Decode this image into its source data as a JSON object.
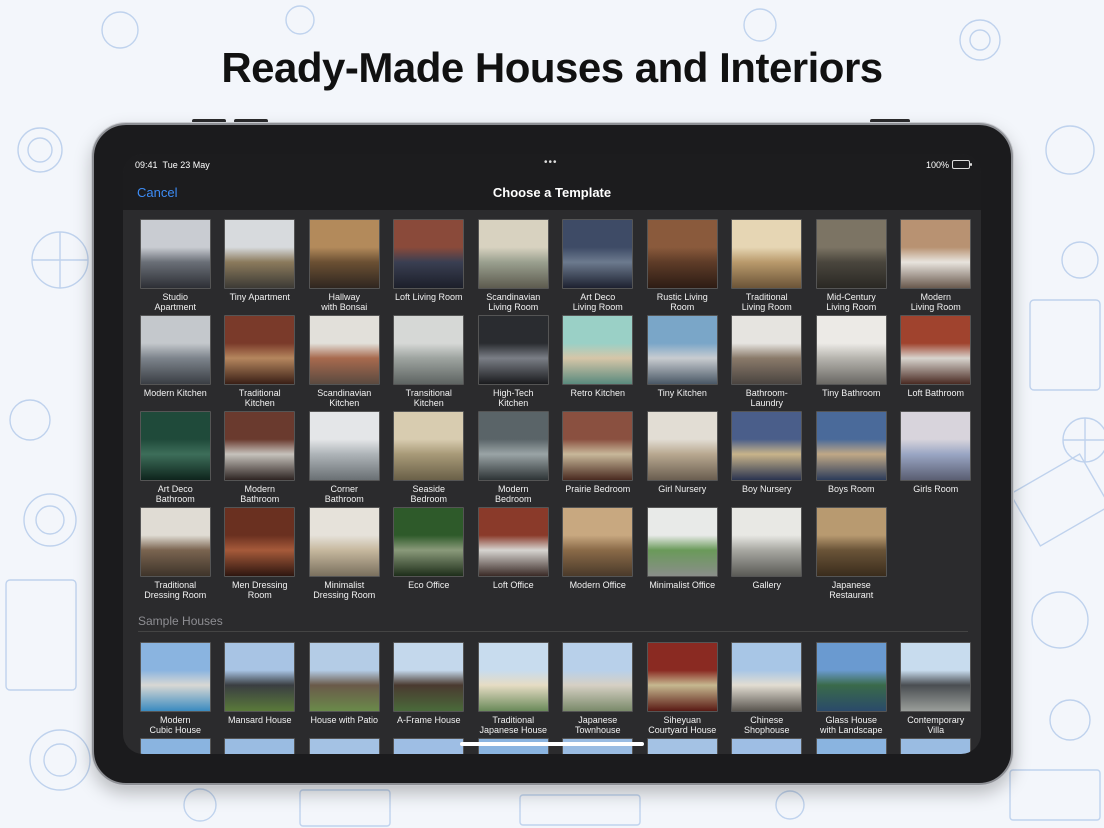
{
  "headline": "Ready-Made Houses and Interiors",
  "status": {
    "time": "09:41",
    "date": "Tue 23 May",
    "dots": "•••",
    "battery": "100%"
  },
  "nav": {
    "cancel": "Cancel",
    "title": "Choose a Template"
  },
  "templates": [
    {
      "label": "Studio\nApartment",
      "colors": [
        "#c9ccd2",
        "#6a6f77",
        "#2d2f35"
      ]
    },
    {
      "label": "Tiny Apartment",
      "colors": [
        "#d7dadd",
        "#8b7a5c",
        "#3c3a35"
      ]
    },
    {
      "label": "Hallway\nwith Bonsai",
      "colors": [
        "#b38a5b",
        "#6b5033",
        "#2f2620"
      ]
    },
    {
      "label": "Loft Living Room",
      "colors": [
        "#8a4a3a",
        "#3a3f52",
        "#1c1f2a"
      ]
    },
    {
      "label": "Scandinavian\nLiving Room",
      "colors": [
        "#d8d2c0",
        "#9aa08f",
        "#5d5b4f"
      ]
    },
    {
      "label": "Art Deco\nLiving Room",
      "colors": [
        "#3e4b66",
        "#6c7a8e",
        "#1d2130"
      ]
    },
    {
      "label": "Rustic Living\nRoom",
      "colors": [
        "#8a5a3c",
        "#5e3c28",
        "#2d1c14"
      ]
    },
    {
      "label": "Traditional\nLiving Room",
      "colors": [
        "#e6d6b4",
        "#b99a6c",
        "#6b5438"
      ]
    },
    {
      "label": "Mid-Century\nLiving Room",
      "colors": [
        "#7c7464",
        "#4a463d",
        "#2a2824"
      ]
    },
    {
      "label": "Modern\nLiving Room",
      "colors": [
        "#b89272",
        "#e8e4de",
        "#6a5a4e"
      ]
    },
    {
      "label": "Modern Kitchen",
      "colors": [
        "#c4c8cc",
        "#7d848c",
        "#3a3e44"
      ]
    },
    {
      "label": "Traditional\nKitchen",
      "colors": [
        "#7a3a2a",
        "#b5865e",
        "#3a1f16"
      ]
    },
    {
      "label": "Scandinavian\nKitchen",
      "colors": [
        "#e2e0da",
        "#a86a4e",
        "#5a4a40"
      ]
    },
    {
      "label": "Transitional\nKitchen",
      "colors": [
        "#d6d8d6",
        "#9ea4a0",
        "#5e6462"
      ]
    },
    {
      "label": "High-Tech\nKitchen",
      "colors": [
        "#2a2c30",
        "#7a7e86",
        "#1a1b1e"
      ]
    },
    {
      "label": "Retro Kitchen",
      "colors": [
        "#9ad0c6",
        "#d6c6a8",
        "#5a8a7e"
      ]
    },
    {
      "label": "Tiny Kitchen",
      "colors": [
        "#7aa6c8",
        "#c8ccd0",
        "#4a5866"
      ]
    },
    {
      "label": "Bathroom-\nLaundry",
      "colors": [
        "#e6e4e0",
        "#8a7a6a",
        "#4a4440"
      ]
    },
    {
      "label": "Tiny Bathroom",
      "colors": [
        "#eceae6",
        "#b6b4ae",
        "#6a6864"
      ]
    },
    {
      "label": "Loft Bathroom",
      "colors": [
        "#a0432e",
        "#d8d4ce",
        "#4a2a22"
      ]
    },
    {
      "label": "Art Deco\nBathroom",
      "colors": [
        "#1f4a3a",
        "#3d6e5a",
        "#0e241c"
      ]
    },
    {
      "label": "Modern\nBathroom",
      "colors": [
        "#6a3a2e",
        "#c6c2bc",
        "#2e2422"
      ]
    },
    {
      "label": "Corner\nBathroom",
      "colors": [
        "#e4e6e8",
        "#aeb4b8",
        "#6a7074"
      ]
    },
    {
      "label": "Seaside\nBedroom",
      "colors": [
        "#d8ccb0",
        "#a89a78",
        "#6a6048"
      ]
    },
    {
      "label": "Modern\nBedroom",
      "colors": [
        "#5a6468",
        "#9aa4a6",
        "#2e3436"
      ]
    },
    {
      "label": "Prairie Bedroom",
      "colors": [
        "#8a5040",
        "#c8b89a",
        "#4a2a20"
      ]
    },
    {
      "label": "Girl Nursery",
      "colors": [
        "#e2ddd4",
        "#b8a890",
        "#6a5e50"
      ]
    },
    {
      "label": "Boy Nursery",
      "colors": [
        "#4a5e8a",
        "#c8b48a",
        "#2a3450"
      ]
    },
    {
      "label": "Boys Room",
      "colors": [
        "#4a6a9a",
        "#c0a886",
        "#2c3c5a"
      ]
    },
    {
      "label": "Girls Room",
      "colors": [
        "#d8d4dc",
        "#9aa6c4",
        "#5a5e72"
      ]
    },
    {
      "label": "Traditional\nDressing Room",
      "colors": [
        "#e0dcd4",
        "#7a6450",
        "#3e342a"
      ]
    },
    {
      "label": "Men Dressing\nRoom",
      "colors": [
        "#6a3020",
        "#a65a3a",
        "#2e1610"
      ]
    },
    {
      "label": "Minimalist\nDressing Room",
      "colors": [
        "#e6e2da",
        "#c6b89e",
        "#7a705e"
      ]
    },
    {
      "label": "Eco Office",
      "colors": [
        "#2e5a2a",
        "#8a9a7a",
        "#1e2e1a"
      ]
    },
    {
      "label": "Loft Office",
      "colors": [
        "#8a3a2a",
        "#d6d4d0",
        "#3a2a26"
      ]
    },
    {
      "label": "Modern Office",
      "colors": [
        "#c8a880",
        "#8a6a48",
        "#4a3a2a"
      ]
    },
    {
      "label": "Minimalist Office",
      "colors": [
        "#e8eae8",
        "#6a9a5a",
        "#8a8e8a"
      ]
    },
    {
      "label": "Gallery",
      "colors": [
        "#e8e8e4",
        "#a8a8a2",
        "#5a5a56"
      ]
    },
    {
      "label": "Japanese\nRestaurant",
      "colors": [
        "#b89a70",
        "#6a5438",
        "#3a2c1c"
      ]
    }
  ],
  "sample_houses_title": "Sample Houses",
  "houses": [
    {
      "label": "Modern\nCubic House",
      "colors": [
        "#8ab4e0",
        "#d8d8d4",
        "#3a8ac0"
      ]
    },
    {
      "label": "Mansard House",
      "colors": [
        "#a8c4e4",
        "#3a3e42",
        "#5a7a3a"
      ]
    },
    {
      "label": "House with Patio",
      "colors": [
        "#b4cce6",
        "#6a5a4a",
        "#6a8a4a"
      ]
    },
    {
      "label": "A-Frame House",
      "colors": [
        "#c4d8ec",
        "#4a3a30",
        "#4a6a3a"
      ]
    },
    {
      "label": "Traditional\nJapanese House",
      "colors": [
        "#c8dcee",
        "#e6dcc4",
        "#6a8a5a"
      ]
    },
    {
      "label": "Japanese\nTownhouse",
      "colors": [
        "#b8d0ea",
        "#d6d0c4",
        "#7a8a6a"
      ]
    },
    {
      "label": "Siheyuan\nCourtyard House",
      "colors": [
        "#8a2a22",
        "#c6b890",
        "#5a1a14"
      ]
    },
    {
      "label": "Chinese\nShophouse",
      "colors": [
        "#a8c6e6",
        "#e2ddd2",
        "#5a5650"
      ]
    },
    {
      "label": "Glass House\nwith Landscape",
      "colors": [
        "#6a9ad0",
        "#3a6a4a",
        "#2a4a6a"
      ]
    },
    {
      "label": "Contemporary\nVilla",
      "colors": [
        "#c8dcee",
        "#4a4e52",
        "#9a9e9a"
      ]
    }
  ],
  "houses_row2": [
    {
      "label": "",
      "colors": [
        "#8ab4e0",
        "#a8c4e4",
        "#a8c4e4"
      ]
    },
    {
      "label": "",
      "colors": [
        "#9abce2",
        "#b4cce6",
        "#b4cce6"
      ]
    },
    {
      "label": "",
      "colors": [
        "#a4c2e4",
        "#c0d4ea",
        "#c0d4ea"
      ]
    },
    {
      "label": "",
      "colors": [
        "#9ebee4",
        "#b8d0ea",
        "#b8d0ea"
      ]
    },
    {
      "label": "",
      "colors": [
        "#8ab4e0",
        "#a8c4e4",
        "#a8c4e4"
      ]
    },
    {
      "label": "",
      "colors": [
        "#9abce2",
        "#b4cce6",
        "#b4cce6"
      ]
    },
    {
      "label": "",
      "colors": [
        "#a4c2e4",
        "#c0d4ea",
        "#c0d4ea"
      ]
    },
    {
      "label": "",
      "colors": [
        "#9ebee4",
        "#b8d0ea",
        "#b8d0ea"
      ]
    },
    {
      "label": "",
      "colors": [
        "#8ab4e0",
        "#a8c4e4",
        "#a8c4e4"
      ]
    },
    {
      "label": "",
      "colors": [
        "#9abce2",
        "#b4cce6",
        "#b4cce6"
      ]
    }
  ]
}
